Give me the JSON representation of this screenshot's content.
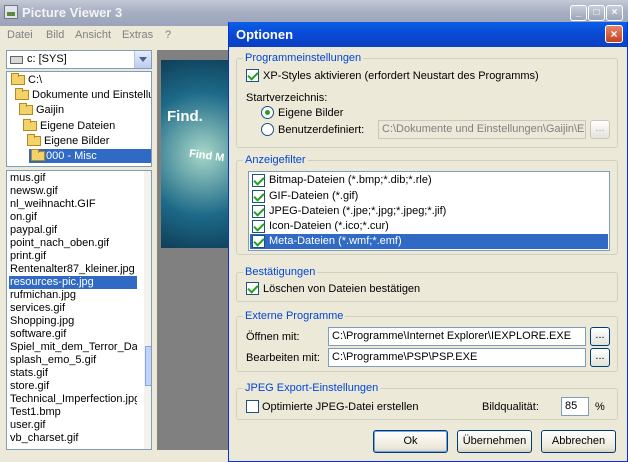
{
  "main_window": {
    "title": "Picture Viewer 3",
    "controls": {
      "minimize": "_",
      "maximize": "□",
      "close": "×"
    },
    "menu": [
      "Datei",
      "Bild",
      "Ansicht",
      "Extras",
      "?"
    ]
  },
  "drive": {
    "label": "c: [SYS]",
    "icon": "drive-icon"
  },
  "tree": [
    {
      "label": "C:\\",
      "selected": false
    },
    {
      "label": "Dokumente und Einstellungen",
      "selected": false
    },
    {
      "label": "Gaijin",
      "selected": false
    },
    {
      "label": "Eigene Dateien",
      "selected": false
    },
    {
      "label": "Eigene Bilder",
      "selected": false
    },
    {
      "label": "000 - Misc",
      "selected": true
    }
  ],
  "files": [
    "mus.gif",
    "newsw.gif",
    "nl_weihnacht.GIF",
    "on.gif",
    "paypal.gif",
    "point_nach_oben.gif",
    "print.gif",
    "Rentenalter87_kleiner.jpg",
    "resources-pic.jpg",
    "rufmichan.jpg",
    "services.gif",
    "Shopping.jpg",
    "software.gif",
    "Spiel_mit_dem_Terror_Das",
    "splash_emo_5.gif",
    "stats.gif",
    "store.gif",
    "Technical_Imperfection.jpg",
    "Test1.bmp",
    "user.gif",
    "vb_charset.gif"
  ],
  "selected_file": "resources-pic.jpg",
  "preview": {
    "text1": "Find.",
    "text2": "Find M"
  },
  "dialog": {
    "title": "Optionen",
    "close": "×",
    "prog": {
      "legend": "Programmeinstellungen",
      "xp_styles": {
        "label": "XP-Styles aktivieren (erfordert Neustart des Programms)",
        "checked": true
      },
      "start_dir_label": "Startverzeichnis:",
      "radio_eigene": {
        "label": "Eigene Bilder",
        "checked": true
      },
      "radio_custom": {
        "label": "Benutzerdefiniert:",
        "checked": false
      },
      "custom_path": "C:\\Dokumente und Einstellungen\\Gaijin\\Eig",
      "browse": "..."
    },
    "filter": {
      "legend": "Anzeigefilter",
      "items": [
        {
          "label": "Bitmap-Dateien (*.bmp;*.dib;*.rle)",
          "checked": true,
          "selected": false
        },
        {
          "label": "GIF-Dateien (*.gif)",
          "checked": true,
          "selected": false
        },
        {
          "label": "JPEG-Dateien (*.jpe;*.jpg;*.jpeg;*.jif)",
          "checked": true,
          "selected": false
        },
        {
          "label": "Icon-Dateien (*.ico;*.cur)",
          "checked": true,
          "selected": false
        },
        {
          "label": "Meta-Dateien (*.wmf;*.emf)",
          "checked": true,
          "selected": true
        }
      ]
    },
    "confirm": {
      "legend": "Bestätigungen",
      "delete": {
        "label": "Löschen von Dateien bestätigen",
        "checked": true
      }
    },
    "external": {
      "legend": "Externe Programme",
      "open_label": "Öffnen mit:",
      "open_value": "C:\\Programme\\Internet Explorer\\IEXPLORE.EXE",
      "edit_label": "Bearbeiten mit:",
      "edit_value": "C:\\Programme\\PSP\\PSP.EXE",
      "browse": "..."
    },
    "jpeg": {
      "legend": "JPEG Export-Einstellungen",
      "optimize": {
        "label": "Optimierte JPEG-Datei erstellen",
        "checked": false
      },
      "quality_label": "Bildqualität:",
      "quality_value": "85",
      "quality_unit": "%"
    },
    "buttons": {
      "ok": "Ok",
      "apply": "Übernehmen",
      "cancel": "Abbrechen"
    }
  },
  "colors": {
    "accent": "#316ac5",
    "dialog_title": "#0b49d4",
    "group_legend": "#0046d5"
  }
}
